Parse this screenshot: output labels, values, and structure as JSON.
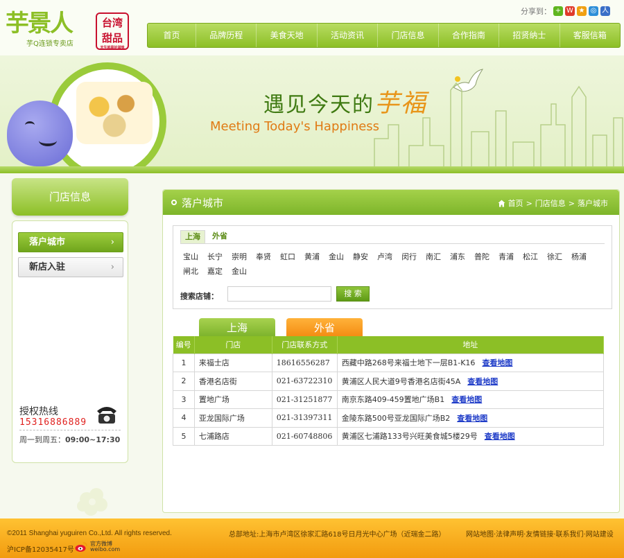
{
  "logo": {
    "brand": "芋景人",
    "sub": "芋Q连锁专卖店",
    "seal_line1": "台湾",
    "seal_line2": "甜品",
    "seal_small": "天生就是好滋味"
  },
  "share": {
    "label": "分享到："
  },
  "nav": [
    "首页",
    "品牌历程",
    "美食天地",
    "活动资讯",
    "门店信息",
    "合作指南",
    "招贤纳士",
    "客服信箱"
  ],
  "banner": {
    "slogan_cn": "遇见今天的",
    "slogan_accent": "芋福",
    "slogan_en": "Meeting Today's Happiness"
  },
  "sidebar": {
    "title": "门店信息",
    "items": [
      {
        "label": "落户城市",
        "active": true
      },
      {
        "label": "新店入驻",
        "active": false
      }
    ],
    "hotline": {
      "title": "授权热线",
      "number": "15316886889",
      "hours_prefix": "周一到周五：",
      "hours": "09:00~17:30"
    }
  },
  "main": {
    "title": "落户城市",
    "breadcrumb": [
      "首页",
      ">",
      "门店信息",
      ">",
      "落户城市"
    ],
    "filter_tabs": [
      "上海",
      "外省"
    ],
    "districts": [
      "宝山",
      "长宁",
      "崇明",
      "奉贤",
      "虹口",
      "黄浦",
      "金山",
      "静安",
      "卢湾",
      "闵行",
      "南汇",
      "浦东",
      "普陀",
      "青浦",
      "松江",
      "徐汇",
      "杨浦",
      "闸北",
      "嘉定",
      "金山"
    ],
    "search_label": "搜索店铺：",
    "search_placeholder": "",
    "search_button": "搜 索",
    "tabs": [
      "上海",
      "外省"
    ],
    "table": {
      "headers": [
        "编号",
        "门店",
        "门店联系方式",
        "地址"
      ],
      "map_link": "查看地图",
      "rows": [
        {
          "no": "1",
          "store": "来福士店",
          "phone": "18616556287",
          "address": "西藏中路268号来福士地下一层B1-K16"
        },
        {
          "no": "2",
          "store": "香港名店街",
          "phone": "021-63722310",
          "address": "黄浦区人民大道9号香港名店街45A"
        },
        {
          "no": "3",
          "store": "置地广场",
          "phone": "021-31251877",
          "address": "南京东路409-459置地广场B1"
        },
        {
          "no": "4",
          "store": "亚龙国际广场",
          "phone": "021-31397311",
          "address": "金陵东路500号亚龙国际广场B2"
        },
        {
          "no": "5",
          "store": "七浦路店",
          "phone": "021-60748806",
          "address": "黄浦区七浦路133号兴旺美食城5楼29号"
        }
      ]
    }
  },
  "footer": {
    "copyright": "©2011 Shanghai yuguiren Co.,Ltd. All rights reserved.",
    "icp": "沪ICP备12035417号",
    "weibo_line1": "官方微博",
    "weibo_line2": "weibo.com",
    "address": "总部地址:上海市卢湾区徐家汇路618号日月光中心广场（近瑞金二路）",
    "links": "网站地图·法律声明·友情链接·联系我们·网站建设"
  },
  "colors": {
    "brand_green": "#8cbf26",
    "orange": "#f38a10",
    "link_blue": "#1f3cc8",
    "hotline_red": "#e0201e"
  }
}
